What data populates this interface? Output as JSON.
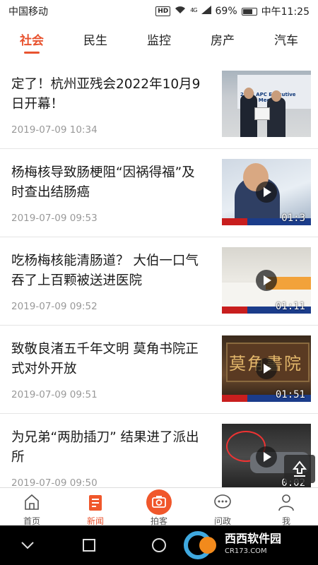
{
  "status_bar": {
    "carrier": "中国移动",
    "hd": "HD",
    "network": "4G",
    "battery": "69%",
    "time": "中午11:25"
  },
  "tabs": [
    {
      "label": "社会",
      "active": true
    },
    {
      "label": "民生",
      "active": false
    },
    {
      "label": "监控",
      "active": false
    },
    {
      "label": "房产",
      "active": false
    },
    {
      "label": "汽车",
      "active": false
    }
  ],
  "news": [
    {
      "title": "定了！杭州亚残会2022年10月9日开幕！",
      "date": "2019-07-09 10:34",
      "is_video": false,
      "thumb_banner": "22nd APC Executive Board Meeting"
    },
    {
      "title": "杨梅核导致肠梗阻“因祸得福”及时查出结肠癌",
      "date": "2019-07-09 09:53",
      "is_video": true,
      "duration": "01:3"
    },
    {
      "title": "吃杨梅核能清肠道？ 大伯一口气吞了上百颗被送进医院",
      "date": "2019-07-09 09:52",
      "is_video": true,
      "duration": "01:11"
    },
    {
      "title": "致敬良渚五千年文明 莫角书院正式对外开放",
      "date": "2019-07-09 09:51",
      "is_video": true,
      "duration": "01:51",
      "thumb_sign": "莫角書院"
    },
    {
      "title": "为兄弟“两肋插刀” 结果进了派出所",
      "date": "2019-07-09 09:50",
      "is_video": true,
      "duration": "0:02"
    }
  ],
  "bottom_nav": [
    {
      "label": "首页",
      "icon": "home-icon",
      "active": false
    },
    {
      "label": "新闻",
      "icon": "news-icon",
      "active": true
    },
    {
      "label": "拍客",
      "icon": "camera-icon",
      "active": false
    },
    {
      "label": "问政",
      "icon": "chat-icon",
      "active": false
    },
    {
      "label": "我",
      "icon": "user-icon",
      "active": false
    }
  ],
  "watermark": {
    "name": "西西软件园",
    "url": "CR173.COM"
  },
  "colors": {
    "accent": "#e8532f"
  }
}
